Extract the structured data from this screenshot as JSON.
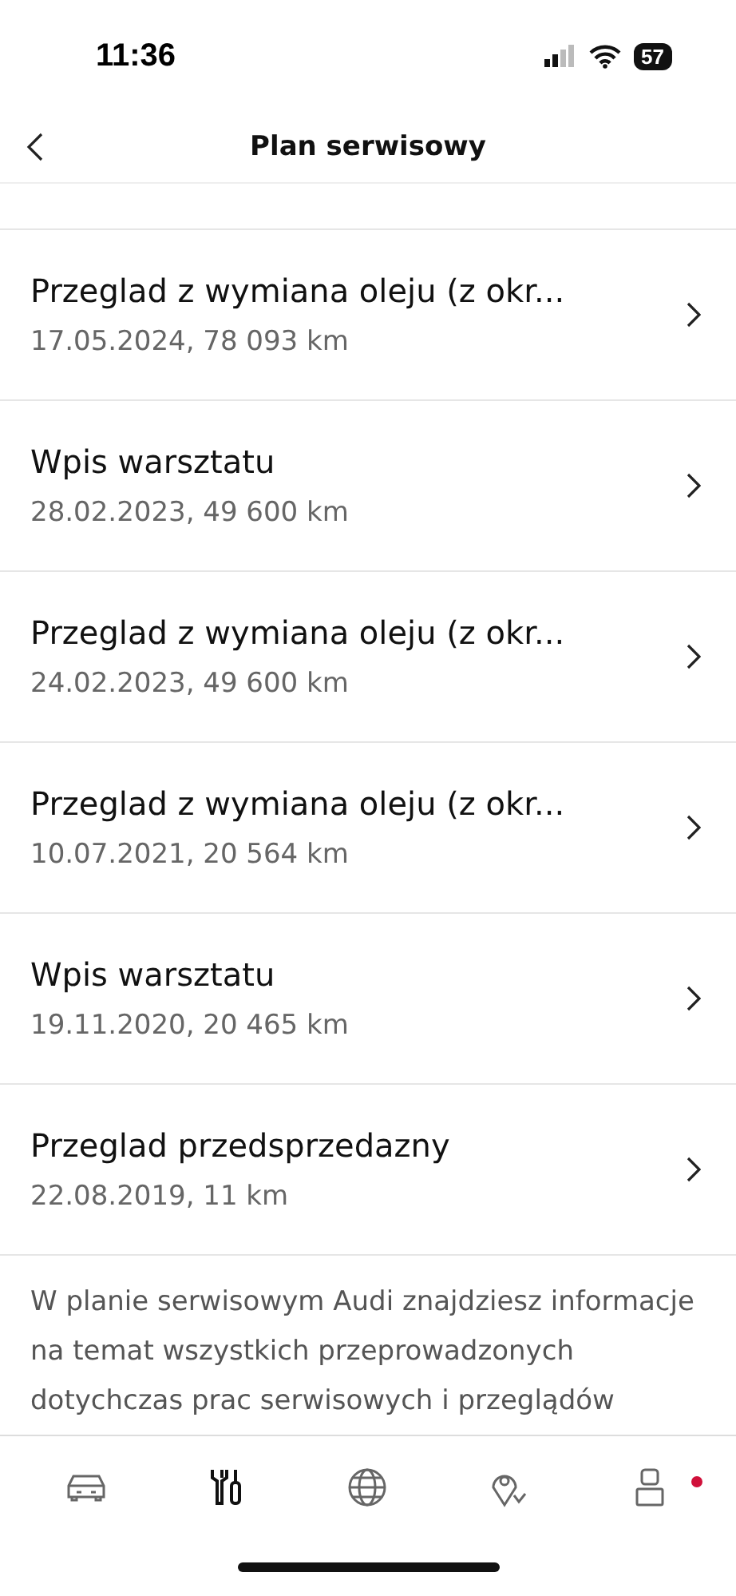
{
  "status_bar": {
    "time": "11:36",
    "battery": "57"
  },
  "header": {
    "title": "Plan serwisowy"
  },
  "entries": [
    {
      "title": "Przeglad z wymiana oleju (z okr...",
      "detail": "17.05.2024, 78 093 km"
    },
    {
      "title": "Wpis warsztatu",
      "detail": "28.02.2023, 49 600 km"
    },
    {
      "title": "Przeglad z wymiana oleju (z okr...",
      "detail": "24.02.2023, 49 600 km"
    },
    {
      "title": "Przeglad z wymiana oleju (z okr...",
      "detail": "10.07.2021, 20 564 km"
    },
    {
      "title": "Wpis warsztatu",
      "detail": "19.11.2020, 20 465 km"
    },
    {
      "title": "Przeglad przedsprzedazny",
      "detail": "22.08.2019, 11 km"
    }
  ],
  "info_text": "W planie serwisowym Audi znajdziesz informacje na temat wszystkich przeprowadzonych dotychczas prac serwisowych i przeglądów",
  "tab_bar": [
    {
      "kind": "car",
      "selected": false
    },
    {
      "kind": "tools",
      "selected": true
    },
    {
      "kind": "globe",
      "selected": false
    },
    {
      "kind": "map",
      "selected": false
    },
    {
      "kind": "profile",
      "selected": false,
      "badge": true
    }
  ]
}
